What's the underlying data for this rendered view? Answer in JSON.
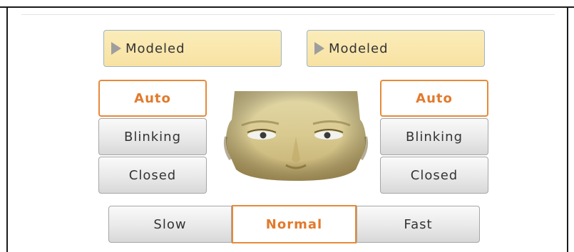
{
  "left_eye": {
    "model_dropdown": {
      "label": "Modeled"
    },
    "modes": [
      {
        "label": "Auto",
        "selected": true
      },
      {
        "label": "Blinking",
        "selected": false
      },
      {
        "label": "Closed",
        "selected": false
      }
    ]
  },
  "right_eye": {
    "model_dropdown": {
      "label": "Modeled"
    },
    "modes": [
      {
        "label": "Auto",
        "selected": true
      },
      {
        "label": "Blinking",
        "selected": false
      },
      {
        "label": "Closed",
        "selected": false
      }
    ]
  },
  "blink_speed": {
    "options": [
      {
        "label": "Slow",
        "selected": false
      },
      {
        "label": "Normal",
        "selected": true
      },
      {
        "label": "Fast",
        "selected": false
      }
    ]
  },
  "face_preview": {
    "icon": "face-icon"
  },
  "colors": {
    "accent": "#e58a3a",
    "dropdown_bg": "#fbecb9",
    "dropdown_border": "#9cb4c6"
  }
}
